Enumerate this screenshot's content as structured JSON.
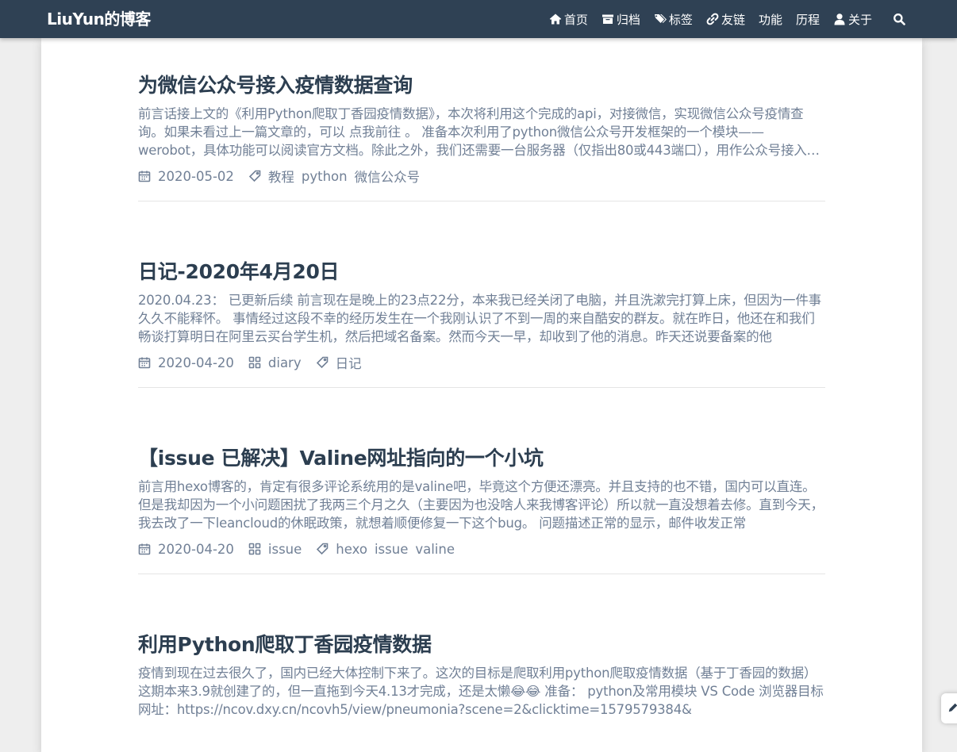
{
  "navbar": {
    "brand": "LiuYun的博客",
    "items": [
      {
        "label": "首页",
        "icon": "home-icon"
      },
      {
        "label": "归档",
        "icon": "archive-icon"
      },
      {
        "label": "标签",
        "icon": "tags-icon"
      },
      {
        "label": "友链",
        "icon": "link-icon"
      },
      {
        "label": "功能",
        "icon": ""
      },
      {
        "label": "历程",
        "icon": ""
      },
      {
        "label": "关于",
        "icon": "user-icon"
      }
    ],
    "search_icon": "search-icon",
    "colors": {
      "background": "#2f4154",
      "text": "#ffffff"
    }
  },
  "posts": [
    {
      "title": "为微信公众号接入疫情数据查询",
      "excerpt": "前言话接上文的《利用Python爬取丁香园疫情数据》，本次将利用这个完成的api，对接微信，实现微信公众号疫情查询。如果未看过上一篇文章的，可以 点我前往 。 准备本次利用了python微信公众号开发框架的一个模块——werobot，具体功能可以阅读官方文档。除此之外，我们还需要一台服务器（仅指出80或443端口），用作公众号接入服务器。",
      "date": "2020-05-02",
      "category": "",
      "tags": [
        "教程",
        "python",
        "微信公众号"
      ]
    },
    {
      "title": "日记-2020年4月20日",
      "excerpt": "2020.04.23： 已更新后续 前言现在是晚上的23点22分，本来我已经关闭了电脑，并且洗漱完打算上床，但因为一件事久久不能释怀。 事情经过这段不幸的经历发生在一个我刚认识了不到一周的来自酷安的群友。就在昨日，他还在和我们畅谈打算明日在阿里云买台学生机，然后把域名备案。然而今天一早，却收到了他的消息。昨天还说要备案的他",
      "date": "2020-04-20",
      "category": "diary",
      "tags": [
        "日记"
      ]
    },
    {
      "title": "【issue 已解决】Valine网址指向的一个小坑",
      "excerpt": "前言用hexo博客的，肯定有很多评论系统用的是valine吧，毕竟这个方便还漂亮。并且支持的也不错，国内可以直连。但是我却因为一个小问题困扰了我两三个月之久（主要因为也没啥人来我博客评论）所以就一直没想着去修。直到今天，我去改了一下leancloud的休眠政策，就想着顺便修复一下这个bug。 问题描述正常的显示，邮件收发正常",
      "date": "2020-04-20",
      "category": "issue",
      "tags": [
        "hexo",
        "issue",
        "valine"
      ]
    },
    {
      "title": "利用Python爬取丁香园疫情数据",
      "excerpt": "疫情到现在过去很久了，国内已经大体控制下来了。这次的目标是爬取利用python爬取疫情数据（基于丁香园的数据）这期本来3.9就创建了的，但一直拖到今天4.13才完成，还是太懒😂😂 准备： python及常用模块 VS Code 浏览器目标网址：https://ncov.dxy.cn/ncovh5/view/pneumonia?scene=2&clicktime=1579579384&",
      "date": "",
      "category": "",
      "tags": []
    }
  ],
  "side_button_icon": "edit-icon"
}
